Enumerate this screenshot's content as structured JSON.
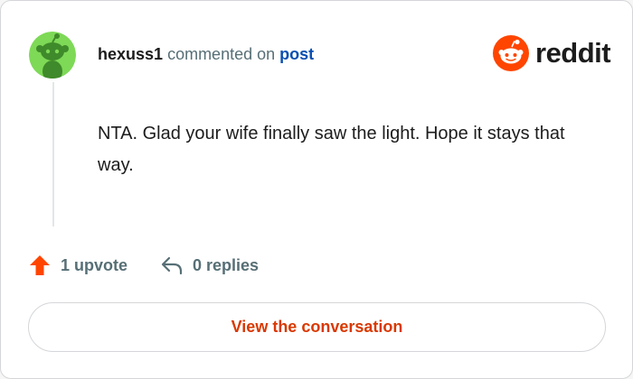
{
  "comment": {
    "author": "hexuss1",
    "action_text": "commented on",
    "target_link": "post",
    "body": "NTA. Glad your wife finally saw the light. Hope it stays that way."
  },
  "brand": {
    "name": "reddit",
    "logo_icon": "reddit-snoo-icon",
    "accent_color": "#ff4500"
  },
  "actions": {
    "upvote_label": "1 upvote",
    "upvote_icon": "upvote-arrow-icon",
    "replies_label": "0 replies",
    "reply_icon": "reply-arrow-icon"
  },
  "cta": {
    "label": "View the conversation",
    "color": "#d93900"
  },
  "avatar": {
    "icon": "snoo-avatar-icon",
    "background": "#7ed957",
    "figure": "#3f8a2a"
  }
}
